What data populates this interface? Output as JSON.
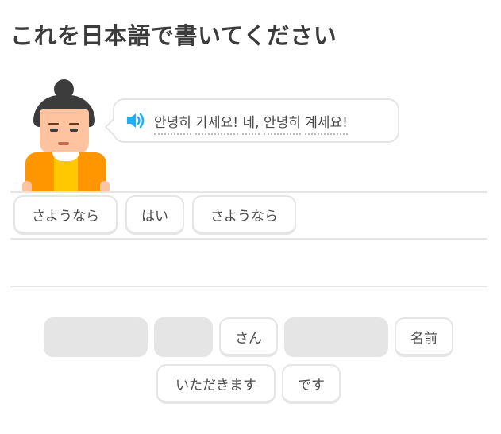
{
  "header": {
    "title": "これを日本語で書いてください"
  },
  "prompt": {
    "speaker_icon": "speaker-icon",
    "words": [
      "안녕히",
      "가세요!",
      "네,",
      "안녕히",
      "계세요!"
    ]
  },
  "answer": {
    "tiles": [
      "さようなら",
      "はい",
      "さようなら"
    ]
  },
  "word_bank": {
    "row1": [
      "",
      "",
      "さん",
      "",
      "名前"
    ],
    "row2": [
      "いただきます",
      "です"
    ]
  },
  "colors": {
    "accent_blue": "#1cb0f6",
    "border": "#e5e5e5",
    "character_body": "#ff9600"
  }
}
